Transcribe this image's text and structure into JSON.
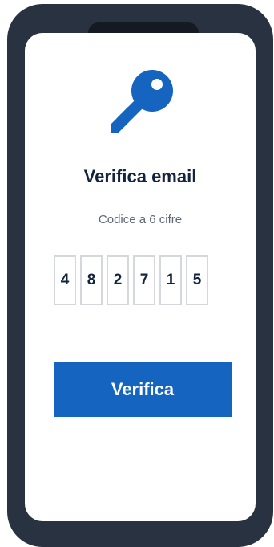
{
  "screen": {
    "title": "Verifica email",
    "subtitle": "Codice a 6 cifre",
    "icon": "key-icon",
    "code_digits": [
      "4",
      "8",
      "2",
      "7",
      "1",
      "5"
    ],
    "button_label": "Verifica"
  },
  "colors": {
    "accent": "#1464c0",
    "phone_frame": "#283241",
    "title_text": "#13243f"
  }
}
